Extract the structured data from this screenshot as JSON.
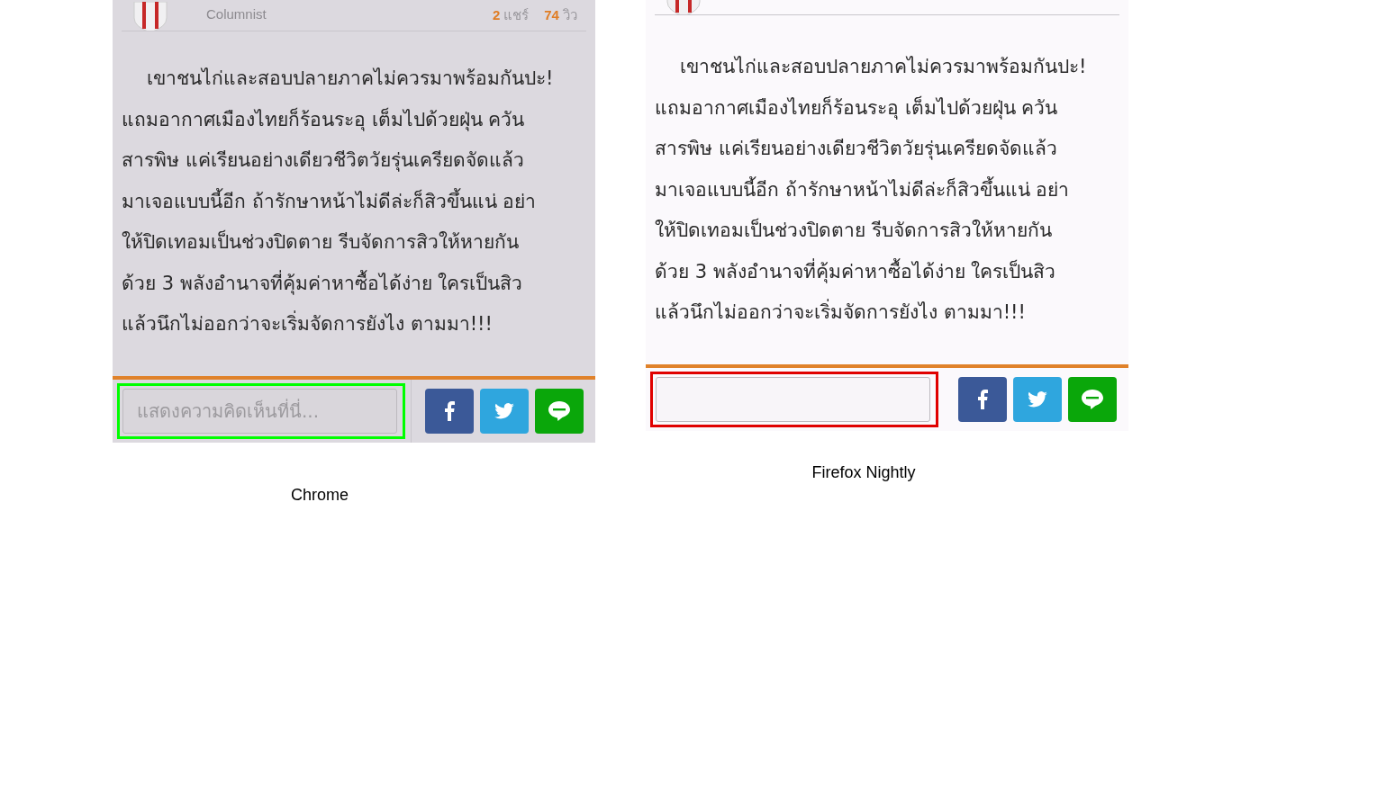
{
  "panels": [
    {
      "kind": "dimmed",
      "header": {
        "role": "Columnist",
        "shares": "2",
        "shares_label": "แชร์",
        "views": "74",
        "views_label": "วิว"
      },
      "paragraph": "เขาชนไก่และสอบปลายภาคไม่ควรมาพร้อมกันปะ!\nแถมอากาศเมืองไทยก็ร้อนระอุ เต็มไปด้วยฝุ่น ควัน\nสารพิษ แค่เรียนอย่างเดียวชีวิตวัยรุ่นเครียดจัดแล้ว\nมาเจอแบบนี้อีก ถ้ารักษาหน้าไม่ดีล่ะก็สิวขึ้นแน่ อย่า\nให้ปิดเทอมเป็นช่วงปิดตาย รีบจัดการสิวให้หายกัน\nด้วย 3 พลังอำนาจที่คุ้มค่าหาซื้อได้ง่าย ใครเป็นสิว\nแล้วนึกไม่ออกว่าจะเริ่มจัดการยังไง ตามมา!!!",
      "comment_field": {
        "placeholder": "แสดงความคิดเห็นที่นี่..."
      },
      "highlight": {
        "color": "#00ff00"
      },
      "caption": "Chrome"
    },
    {
      "kind": "plain",
      "paragraph": "เขาชนไก่และสอบปลายภาคไม่ควรมาพร้อมกันปะ!\nแถมอากาศเมืองไทยก็ร้อนระอุ เต็มไปด้วยฝุ่น ควัน\nสารพิษ แค่เรียนอย่างเดียวชีวิตวัยรุ่นเครียดจัดแล้ว\nมาเจอแบบนี้อีก ถ้ารักษาหน้าไม่ดีล่ะก็สิวขึ้นแน่ อย่า\nให้ปิดเทอมเป็นช่วงปิดตาย รีบจัดการสิวให้หายกัน\nด้วย 3 พลังอำนาจที่คุ้มค่าหาซื้อได้ง่าย ใครเป็นสิว\nแล้วนึกไม่ออกว่าจะเริ่มจัดการยังไง ตามมา!!!",
      "highlight": {
        "color": "#e00000"
      },
      "caption": "Firefox Nightly"
    }
  ]
}
